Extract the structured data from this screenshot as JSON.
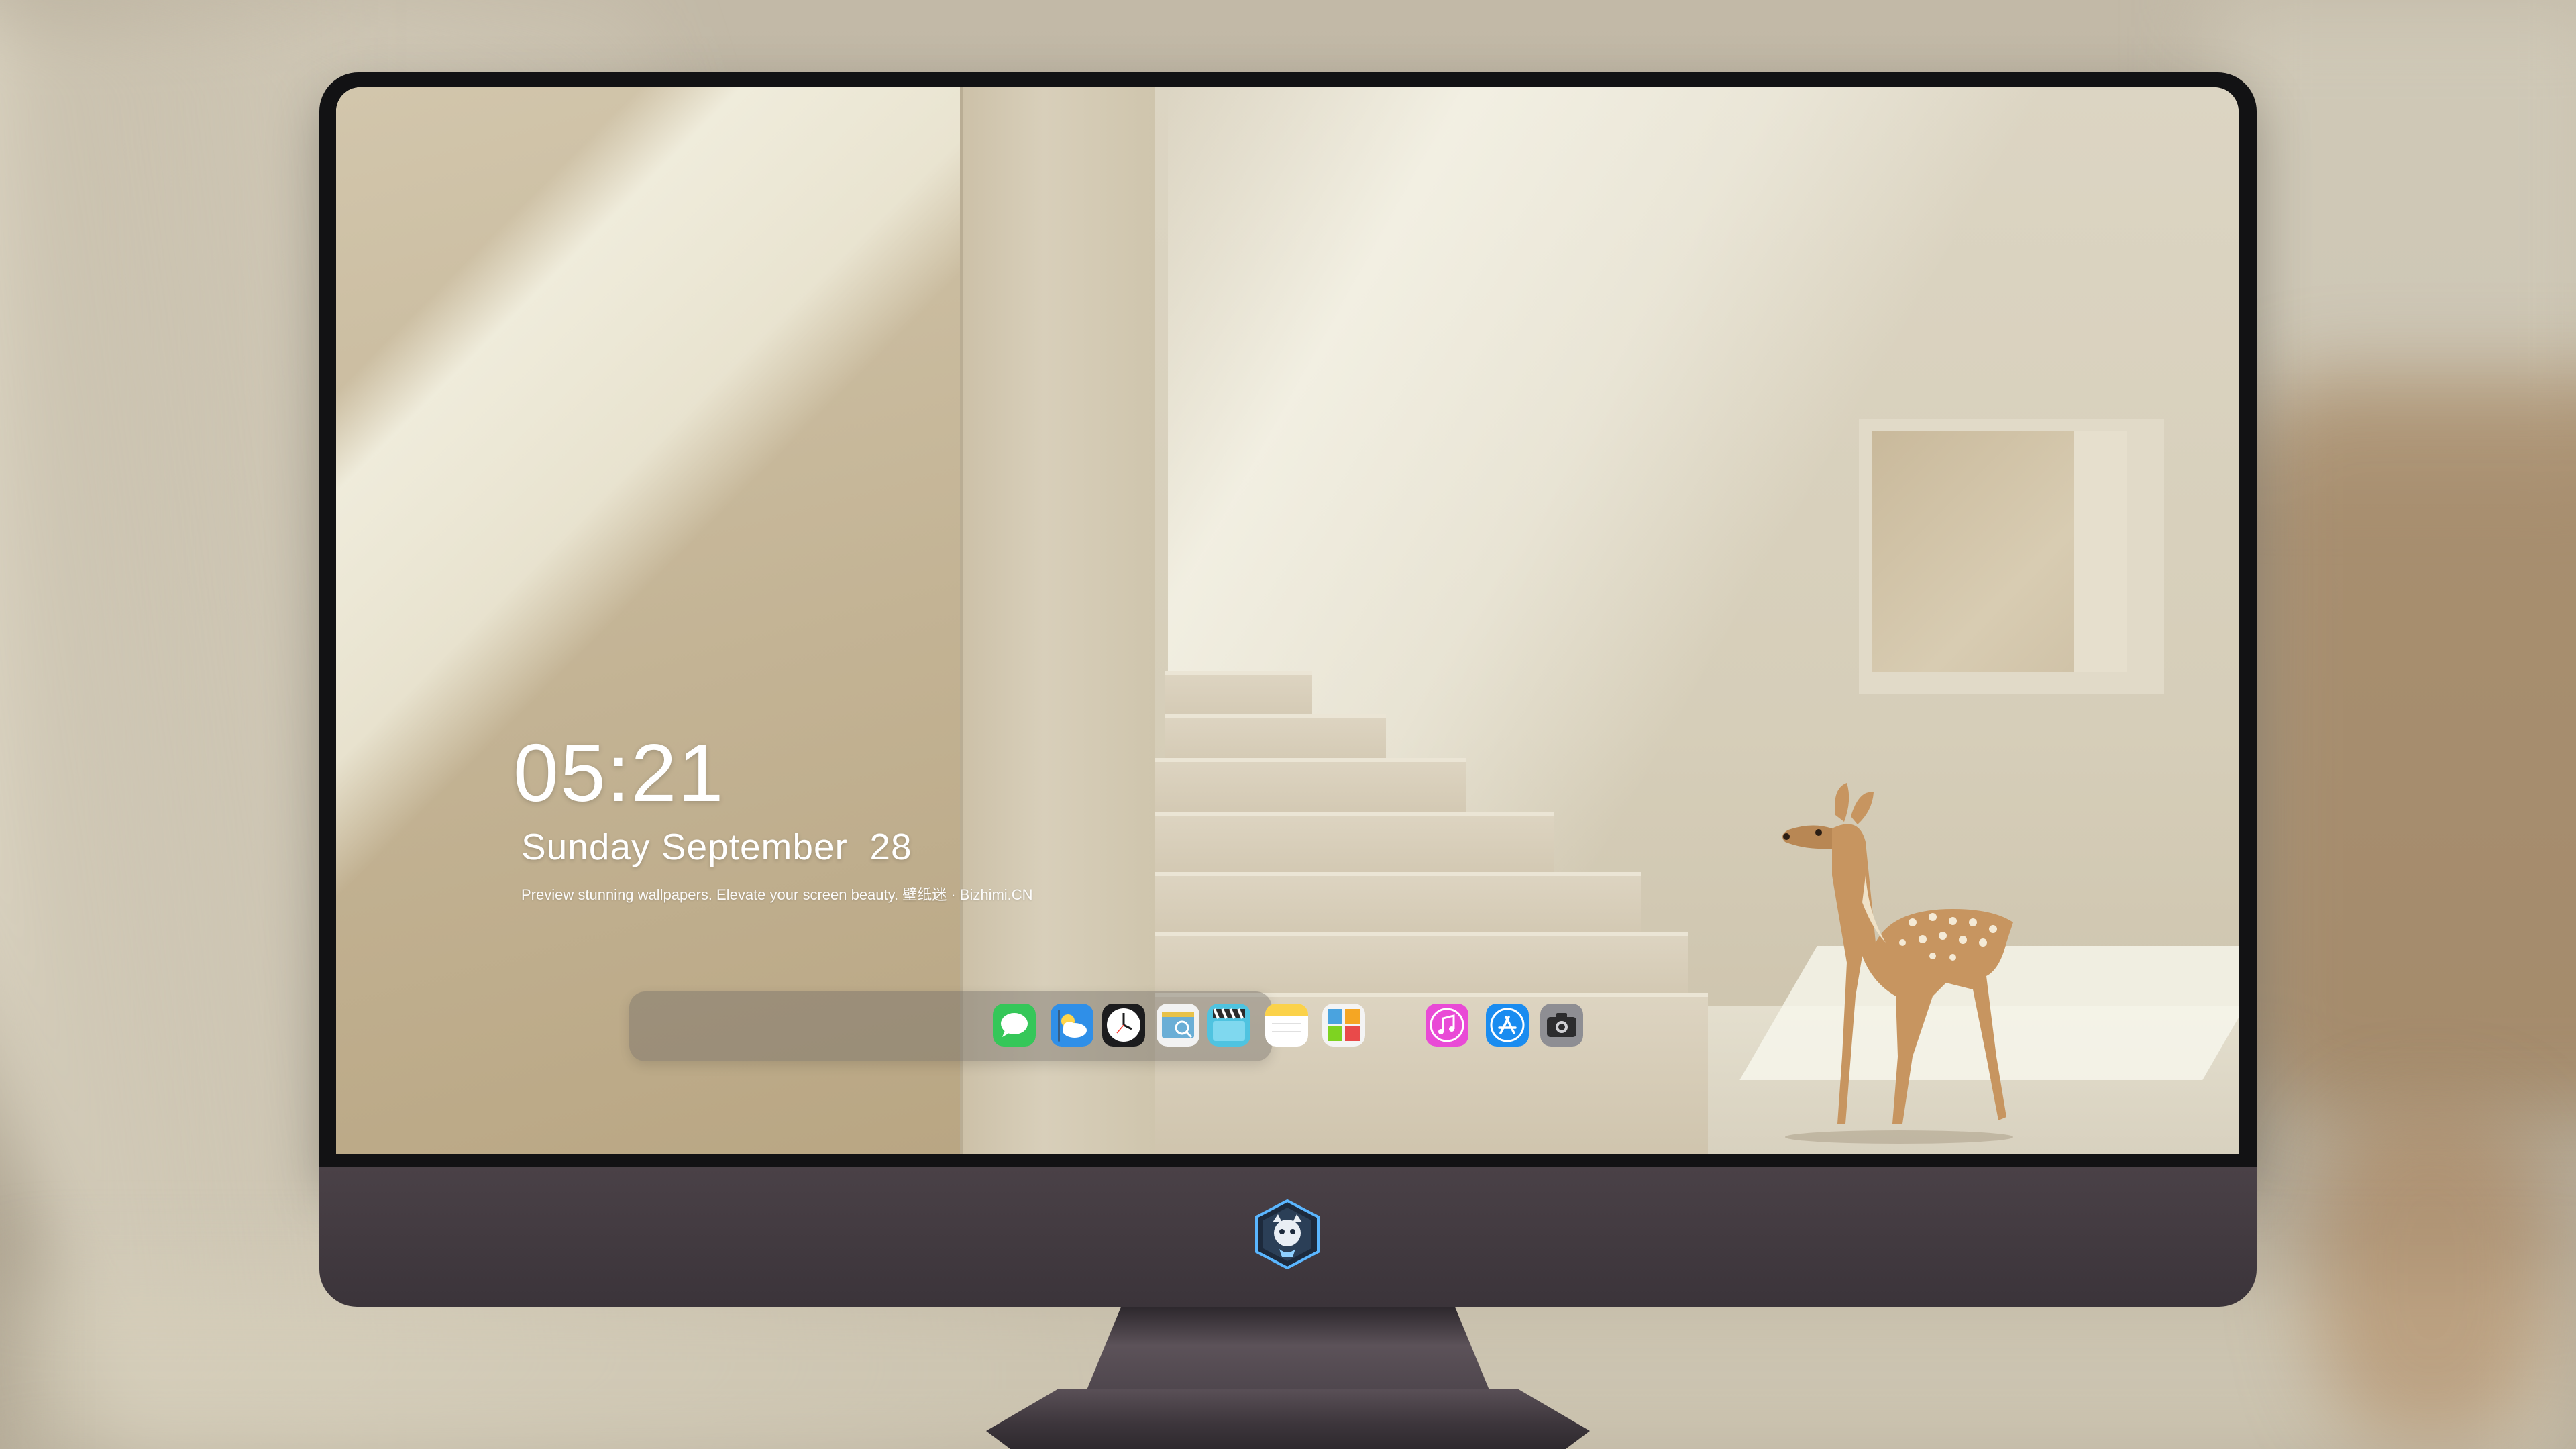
{
  "lock_screen": {
    "time": "05:21",
    "date": "Sunday September  28",
    "tagline": "Preview stunning wallpapers. Elevate your screen beauty. 壁纸迷 · Bizhimi.CN"
  },
  "dock": {
    "items": [
      {
        "name": "messages-icon",
        "color": "#35c759"
      },
      {
        "name": "weather-icon",
        "color": "#2f8fe8"
      },
      {
        "name": "clock-icon",
        "color": "#1c1c1e"
      },
      {
        "name": "preview-icon",
        "color": "#6aaed6"
      },
      {
        "name": "video-editor-icon",
        "color": "#4fc3e0"
      },
      {
        "name": "notes-icon",
        "color": "#fbd24a"
      },
      {
        "name": "photo-gallery-icon",
        "color": "#4aa3df"
      },
      {
        "name": "music-icon",
        "color": "#e94ad6"
      },
      {
        "name": "app-store-icon",
        "color": "#1a8cf0"
      },
      {
        "name": "camera-icon",
        "color": "#8e8e93"
      }
    ]
  },
  "colors": {
    "bezel": "#121214",
    "chin": "#3f373d",
    "dock_background": "rgba(110,104,100,0.42)",
    "clock_text": "#ffffff"
  }
}
